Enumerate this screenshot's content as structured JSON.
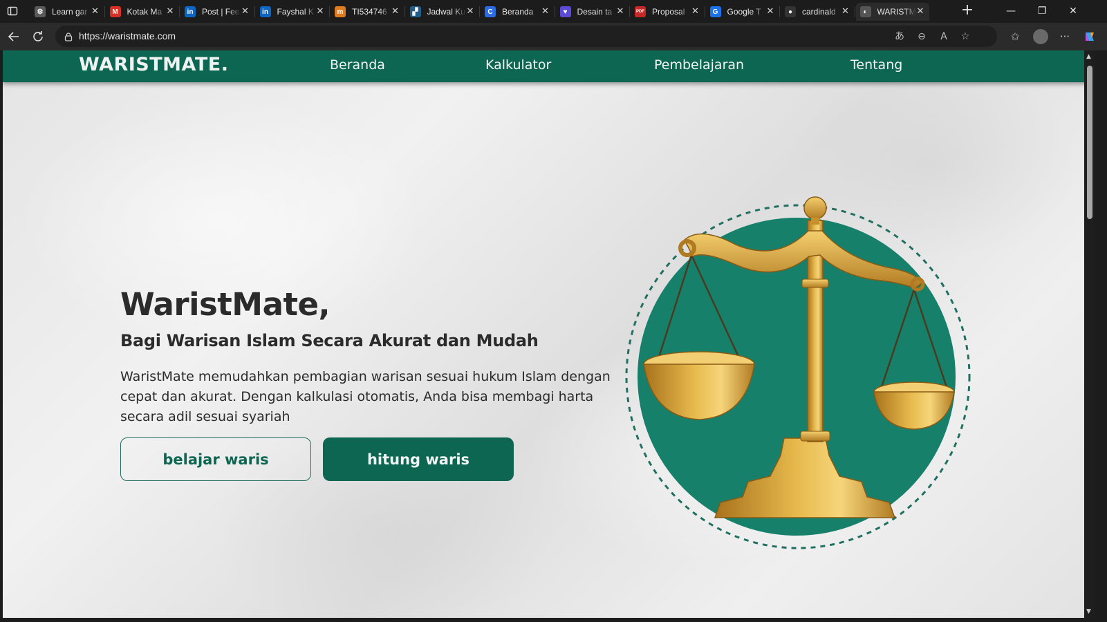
{
  "browser": {
    "tabs": [
      {
        "title": "Learn gar",
        "icon": "globe-icon",
        "color": "#5a5a5a",
        "glyph": "⚙"
      },
      {
        "title": "Kotak Ma",
        "icon": "gmail-icon",
        "color": "#d93025",
        "glyph": "M"
      },
      {
        "title": "Post | Fee",
        "icon": "linkedin-icon",
        "color": "#0a66c2",
        "glyph": "in"
      },
      {
        "title": "Fayshal K",
        "icon": "linkedin-icon",
        "color": "#0a66c2",
        "glyph": "in"
      },
      {
        "title": "TI534746",
        "icon": "site-icon",
        "color": "#e07a1f",
        "glyph": "m"
      },
      {
        "title": "Jadwal Ku",
        "icon": "site-icon",
        "color": "#1f5e8a",
        "glyph": "▞"
      },
      {
        "title": "Beranda",
        "icon": "canva-icon",
        "color": "#2d6be4",
        "glyph": "C"
      },
      {
        "title": "Desain ta",
        "icon": "heart-icon",
        "color": "#5b4bd6",
        "glyph": "♥"
      },
      {
        "title": "Proposal",
        "icon": "pdf-icon",
        "color": "#c62828",
        "glyph": "PDF"
      },
      {
        "title": "Google T",
        "icon": "translate-icon",
        "color": "#1a73e8",
        "glyph": "G"
      },
      {
        "title": "cardinald",
        "icon": "github-icon",
        "color": "#333333",
        "glyph": "●"
      },
      {
        "title": "WARISTM",
        "icon": "globe-icon",
        "color": "#555555",
        "glyph": "◐",
        "active": true
      }
    ],
    "url": "https://waristmate.com"
  },
  "site": {
    "logo": "WARISTMATE.",
    "nav": [
      "Beranda",
      "Kalkulator",
      "Pembelajaran",
      "Tentang"
    ],
    "hero": {
      "title": "WaristMate,",
      "subtitle": "Bagi Warisan Islam Secara Akurat dan Mudah",
      "description": "WaristMate memudahkan pembagian warisan sesuai hukum Islam dengan cepat dan akurat. Dengan kalkulasi otomatis, Anda bisa membagi harta secara adil sesuai syariah",
      "btn_learn": "belajar waris",
      "btn_calc": "hitung waris"
    },
    "colors": {
      "primary": "#0d6651",
      "circle": "#16806a",
      "gold": "#d9a63a",
      "text": "#2b2b2b"
    }
  }
}
